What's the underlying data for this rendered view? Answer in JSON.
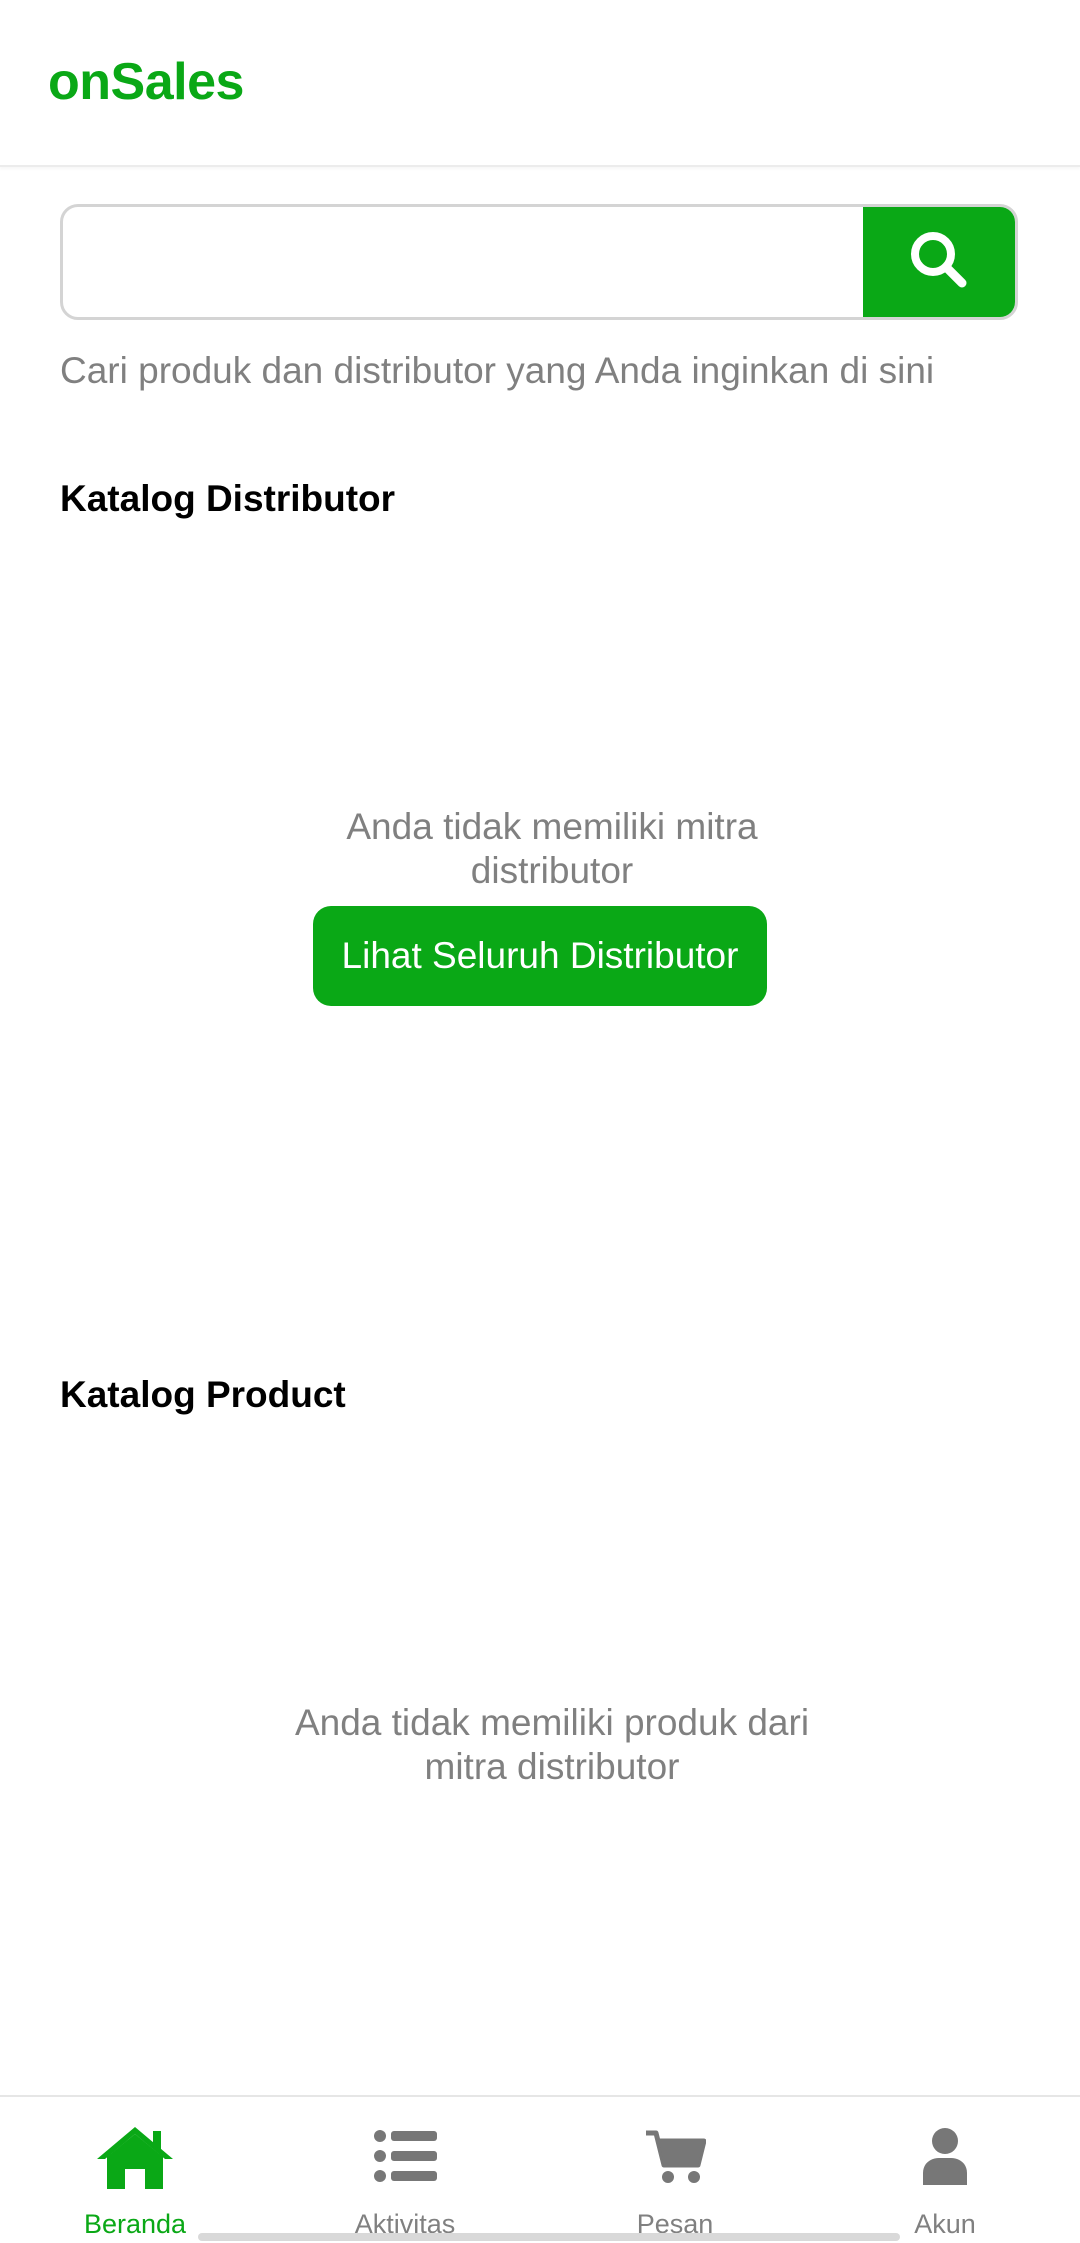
{
  "app": {
    "brand": "onSales",
    "accent_color": "#0aa816"
  },
  "search": {
    "value": "",
    "placeholder": "",
    "button_icon": "search-icon",
    "hint": "Cari produk dan distributor yang Anda inginkan di sini"
  },
  "distributor_section": {
    "title": "Katalog Distributor",
    "empty_line1": "Anda tidak memiliki mitra",
    "empty_line2": "distributor",
    "button_label": "Lihat Seluruh Distributor"
  },
  "product_section": {
    "title": "Katalog Product",
    "empty_line1": "Anda tidak memiliki produk dari",
    "empty_line2": "mitra distributor"
  },
  "bottom_nav": {
    "items": [
      {
        "label": "Beranda",
        "icon": "home-icon",
        "active": true
      },
      {
        "label": "Aktivitas",
        "icon": "list-icon",
        "active": false
      },
      {
        "label": "Pesan",
        "icon": "cart-icon",
        "active": false
      },
      {
        "label": "Akun",
        "icon": "user-icon",
        "active": false
      }
    ]
  }
}
